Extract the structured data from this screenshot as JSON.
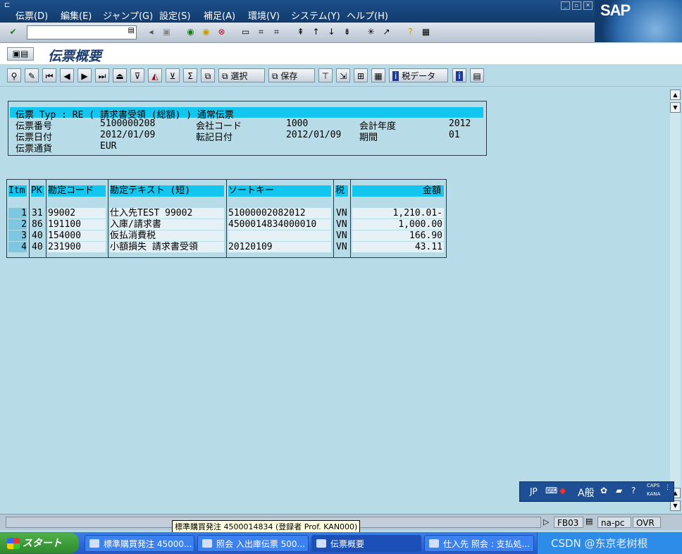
{
  "menu": [
    "伝票(D)",
    "編集(E)",
    "ジャンプ(G)",
    "設定(S)",
    "補足(A)",
    "環境(V)",
    "システム(Y)",
    "ヘルプ(H)"
  ],
  "brand": "SAP",
  "page_title": "伝票概要",
  "app_toolbar": {
    "select_label": "選択",
    "save_label": "保存",
    "tax_data_label": "税データ"
  },
  "header": {
    "doc_type_line": "伝票 Typ : RE ( 請求書受領 (総額) ) 通常伝票",
    "doc_no_label": "伝票番号",
    "doc_no": "5100000208",
    "company_label": "会社コード",
    "company": "1000",
    "fy_label": "会計年度",
    "fy": "2012",
    "doc_date_label": "伝票日付",
    "doc_date": "2012/01/09",
    "post_date_label": "転記日付",
    "post_date": "2012/01/09",
    "period_label": "期間",
    "period": "01",
    "currency_label": "伝票通貨",
    "currency": "EUR"
  },
  "items_table": {
    "columns": [
      "Itm",
      "PK",
      "勘定コード",
      "勘定テキスト (短)",
      "ソートキー",
      "税",
      "金額"
    ],
    "rows": [
      {
        "itm": "1",
        "pk": "31",
        "account": "99002",
        "text": "仕入先TEST 99002",
        "sort": "51000002082012",
        "tax": "VN",
        "amount": "1,210.01-"
      },
      {
        "itm": "2",
        "pk": "86",
        "account": "191100",
        "text": "入庫/請求書",
        "sort": "4500014834000010",
        "tax": "VN",
        "amount": "1,000.00"
      },
      {
        "itm": "3",
        "pk": "40",
        "account": "154000",
        "text": "仮払消費税",
        "sort": "",
        "tax": "VN",
        "amount": "166.90"
      },
      {
        "itm": "4",
        "pk": "40",
        "account": "231900",
        "text": "小額損失 請求書受領",
        "sort": "20120109",
        "tax": "VN",
        "amount": "43.11"
      }
    ]
  },
  "ime": {
    "lang": "JP",
    "mode": "A般",
    "caps": "CAPS",
    "kana": "KANA"
  },
  "status": {
    "tcode": "FB03",
    "host": "na-pc",
    "mode": "OVR"
  },
  "tooltip": "標準購買発注 4500014834 (登録者 Prof. KAN000)",
  "taskbar": {
    "start": "スタート",
    "tasks": [
      "標準購買発注 45000...",
      "照会 入出庫伝票 500...",
      "伝票概要",
      "仕入先 照会 : 支払処..."
    ],
    "watermark": "CSDN @东京老树根"
  }
}
